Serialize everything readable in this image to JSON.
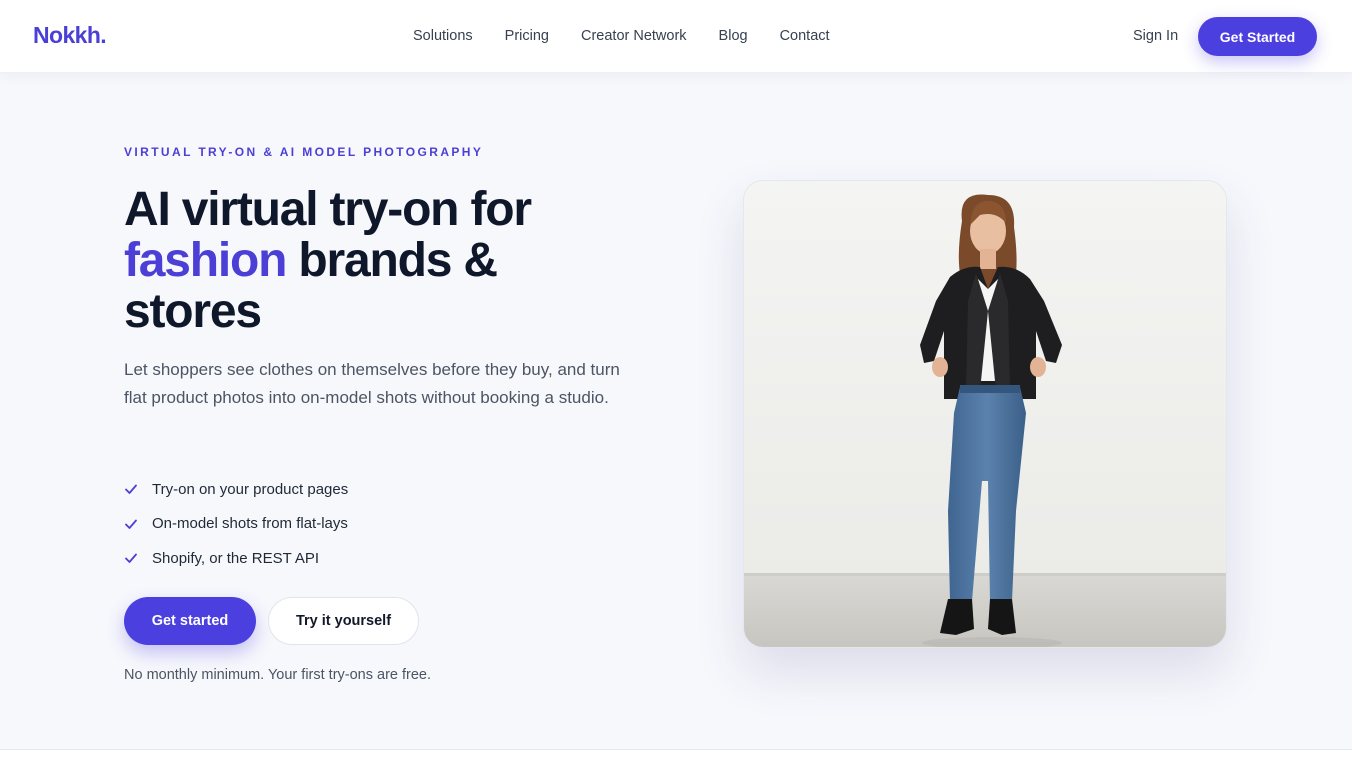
{
  "header": {
    "logo": "Nokkh.",
    "nav": [
      "Solutions",
      "Pricing",
      "Creator Network",
      "Blog",
      "Contact"
    ],
    "sign_in": "Sign In",
    "cta": "Get Started"
  },
  "hero": {
    "eyebrow": "VIRTUAL TRY-ON & AI MODEL PHOTOGRAPHY",
    "headline_part1": "AI virtual try-on for",
    "headline_accent": "fashion",
    "headline_part2": "brands &",
    "headline_part3": "stores",
    "subtext": "Let shoppers see clothes on themselves before they buy, and turn flat product photos into on-model shots without booking a studio.",
    "features": [
      "Try-on on your product pages",
      "On-model shots from flat-lays",
      "Shopify, or the REST API"
    ],
    "primary_button": "Get started",
    "secondary_button": "Try it yourself",
    "note": "No monthly minimum. Your first try-ons are free."
  },
  "colors": {
    "accent": "#4b3fe0",
    "background": "#f7f8fc",
    "heading": "#0f172a"
  },
  "icons": {
    "feature_check": "check-icon"
  }
}
